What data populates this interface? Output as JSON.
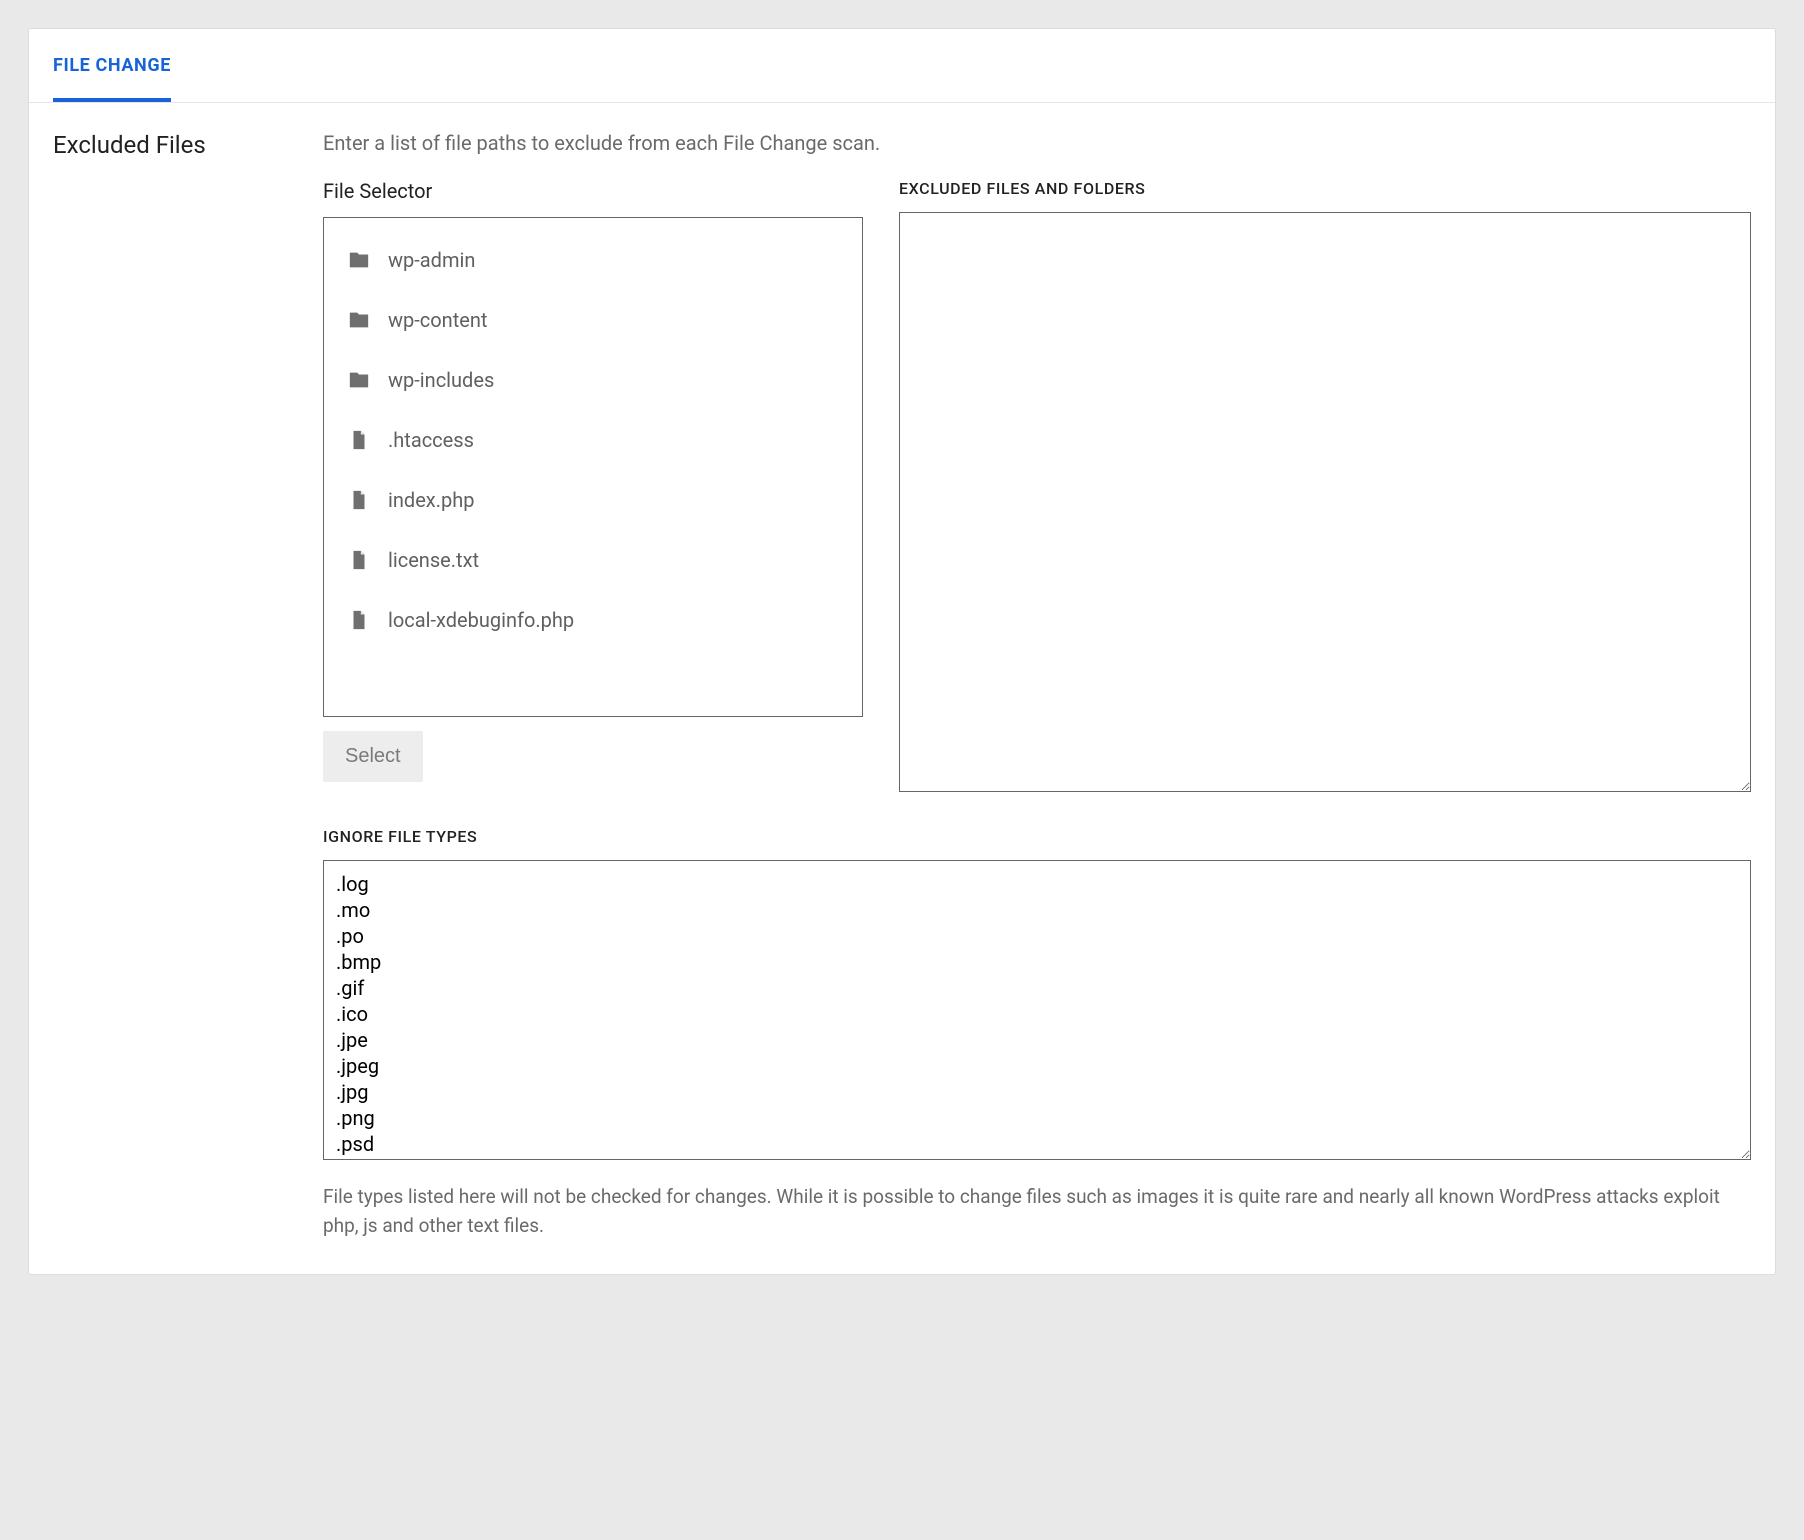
{
  "tab": {
    "label": "FILE CHANGE"
  },
  "section": {
    "title": "Excluded Files",
    "intro": "Enter a list of file paths to exclude from each File Change scan."
  },
  "file_selector": {
    "heading": "File Selector",
    "items": [
      {
        "type": "folder",
        "name": "wp-admin"
      },
      {
        "type": "folder",
        "name": "wp-content"
      },
      {
        "type": "folder",
        "name": "wp-includes"
      },
      {
        "type": "file",
        "name": ".htaccess"
      },
      {
        "type": "file",
        "name": "index.php"
      },
      {
        "type": "file",
        "name": "license.txt"
      },
      {
        "type": "file",
        "name": "local-xdebuginfo.php"
      }
    ],
    "select_button": "Select"
  },
  "excluded": {
    "heading": "EXCLUDED FILES AND FOLDERS",
    "value": ""
  },
  "ignore": {
    "heading": "IGNORE FILE TYPES",
    "value": ".log\n.mo\n.po\n.bmp\n.gif\n.ico\n.jpe\n.jpeg\n.jpg\n.png\n.psd",
    "help": "File types listed here will not be checked for changes. While it is possible to change files such as images it is quite rare and nearly all known WordPress attacks exploit php, js and other text files."
  },
  "icons": {
    "folder": "folder-icon",
    "file": "file-icon"
  }
}
